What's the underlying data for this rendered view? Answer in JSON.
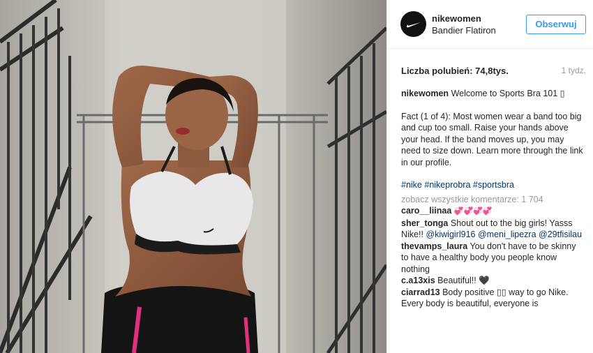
{
  "post": {
    "username": "nikewomen",
    "location": "Bandier Flatiron",
    "follow_label": "Obserwuj",
    "likes_label": "Liczba polubień: 74,8tys.",
    "time": "1 tydz.",
    "caption_user": "nikewomen",
    "caption_first": "Welcome to Sports Bra 101 ▯",
    "caption_body": "Fact (1 of 4): Most women wear a band too big and cup too small. Raise your hands above your head. If the band moves up, you may need to size down. Learn more through the link in our profile.",
    "hashtags": [
      "#nike",
      "#nikeprobra",
      "#sportsbra"
    ],
    "view_all": "zobacz wszystkie komentarze: 1 704"
  },
  "comments": [
    {
      "user": "caro__liinaa",
      "text": "💞💞💞💞"
    },
    {
      "user": "sher_tonga",
      "text": "Shout out to the big girls! Yasss Nike!!",
      "mentions": [
        "@kiwigirl916",
        "@meni_lipezra",
        "@29tfisilau"
      ]
    },
    {
      "user": "thevamps_laura",
      "text": "You don't have to be skinny to have a healthy body you people know nothing"
    },
    {
      "user": "c.a13xis",
      "text": "Beautiful!! 🖤"
    },
    {
      "user": "ciarrad13",
      "text": "Body positive ▯▯ way to go Nike. Every body is beautiful, everyone is"
    }
  ],
  "colors": {
    "link": "#003569",
    "follow": "#3897f0",
    "muted": "#999999"
  }
}
